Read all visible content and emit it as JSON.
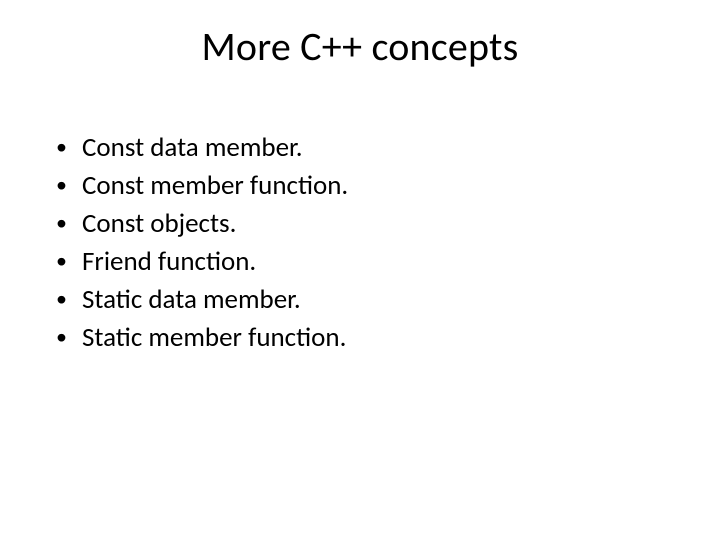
{
  "slide": {
    "title": "More C++ concepts",
    "bullets": [
      "Const data member.",
      "Const member function.",
      "Const objects.",
      "Friend function.",
      "Static data member.",
      "Static member function."
    ]
  }
}
